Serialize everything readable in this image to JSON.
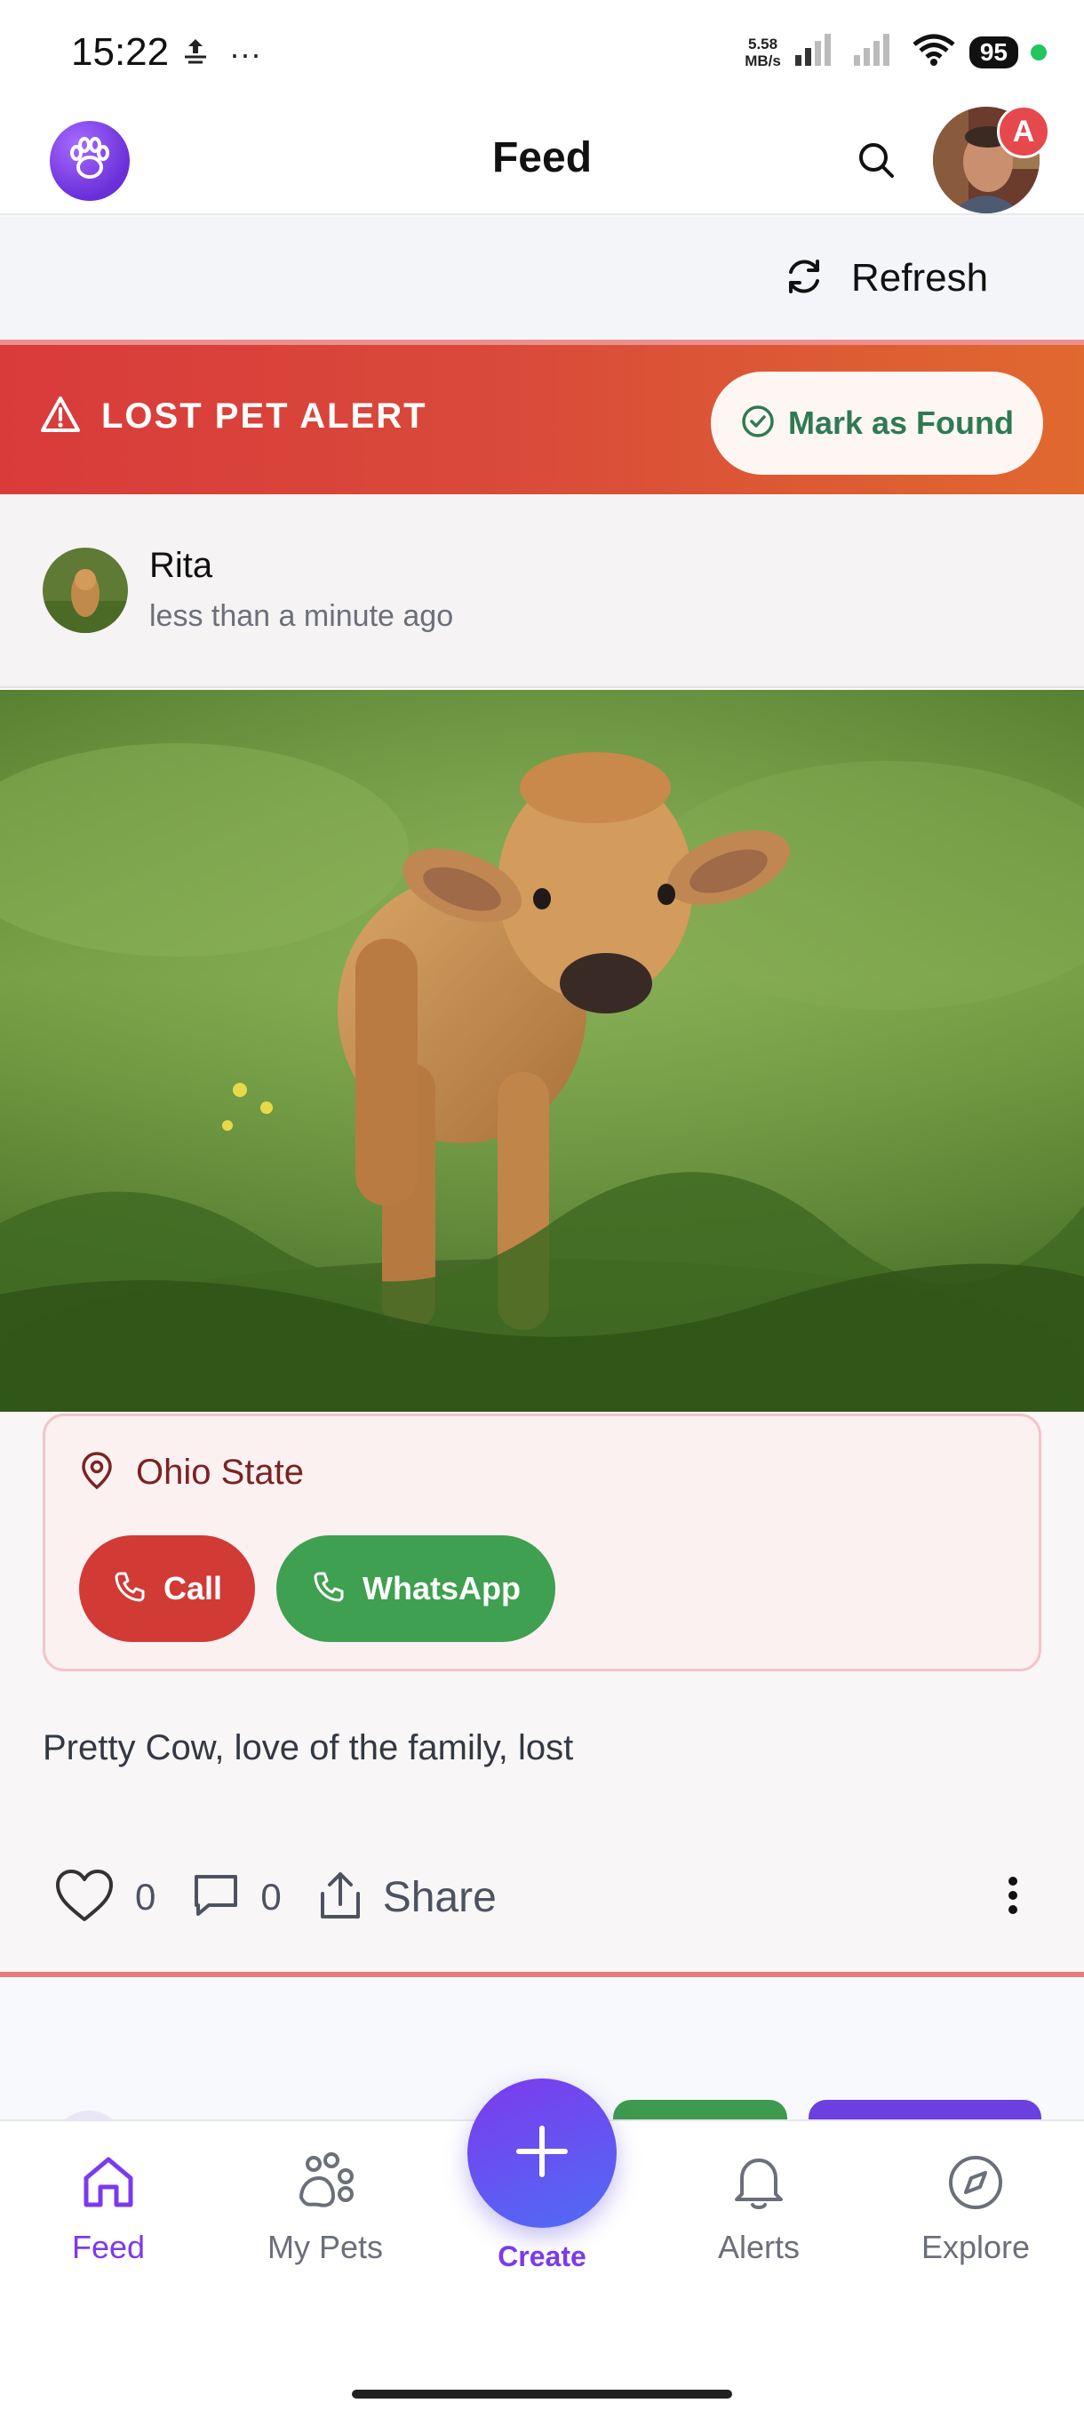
{
  "status_bar": {
    "time": "15:22",
    "dots": "···",
    "net_speed_value": "5.58",
    "net_speed_unit": "MB/s",
    "battery": "95"
  },
  "header": {
    "title": "Feed",
    "avatar_badge": "A"
  },
  "refresh": {
    "label": "Refresh"
  },
  "alert": {
    "title": "LOST PET ALERT",
    "found_button": "Mark as Found"
  },
  "post": {
    "user": "Rita",
    "time": "less than a minute ago",
    "location": "Ohio State",
    "call_label": "Call",
    "whatsapp_label": "WhatsApp",
    "description": "Pretty Cow, love of the family, lost",
    "likes": "0",
    "comments": "0",
    "share_label": "Share"
  },
  "bottom_nav": {
    "items": [
      {
        "label": "Feed"
      },
      {
        "label": "My Pets"
      },
      {
        "label": "Create"
      },
      {
        "label": "Alerts"
      },
      {
        "label": "Explore"
      }
    ]
  },
  "colors": {
    "accent": "#7c3aed",
    "alert_red": "#d93b3b",
    "call_red": "#d13a35",
    "whatsapp_green": "#3ea050"
  }
}
